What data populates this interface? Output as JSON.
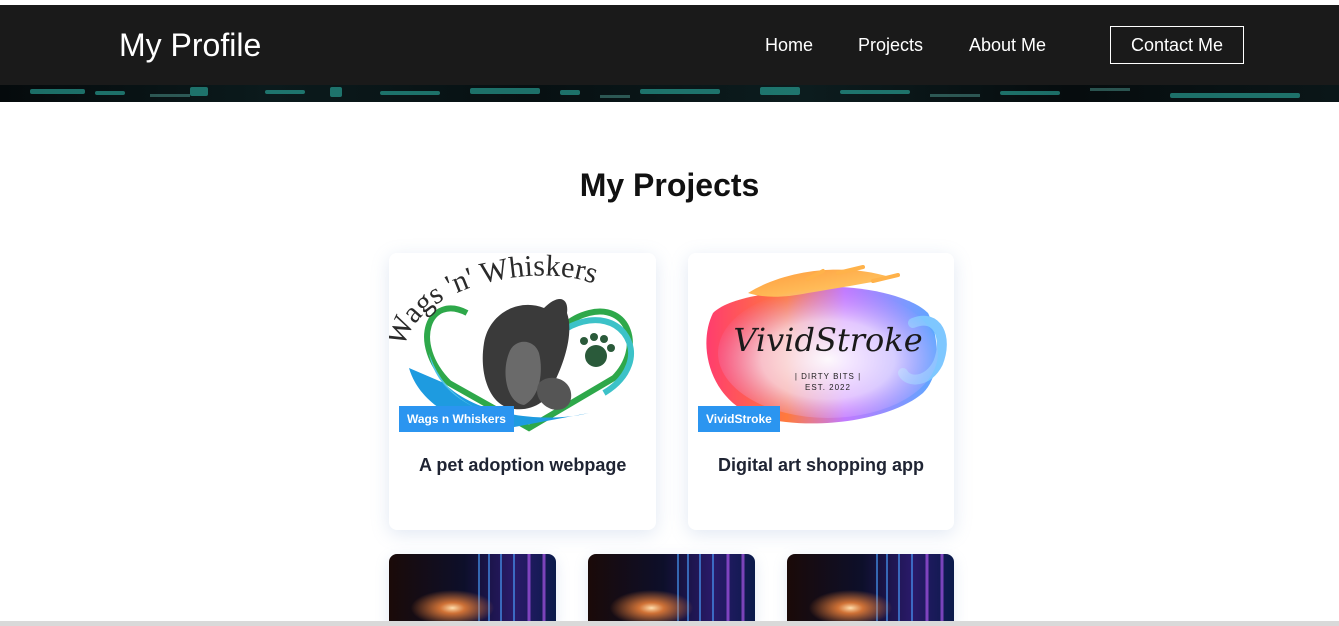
{
  "header": {
    "brand": "My Profile",
    "nav": {
      "home": "Home",
      "projects": "Projects",
      "about": "About Me",
      "contact": "Contact Me"
    }
  },
  "projects": {
    "title": "My Projects",
    "cards": [
      {
        "tag": "Wags n Whiskers",
        "description": "A pet adoption webpage",
        "logo_text": "Wags 'n' Whiskers"
      },
      {
        "tag": "VividStroke",
        "description": "Digital art shopping app",
        "logo_text": "VividStroke",
        "logo_sub1": "| DIRTY BITS |",
        "logo_sub2": "EST. 2022"
      }
    ]
  },
  "colors": {
    "navbar": "#1a1a1a",
    "tag": "#2b95f0",
    "text_dark": "#1f2433"
  }
}
